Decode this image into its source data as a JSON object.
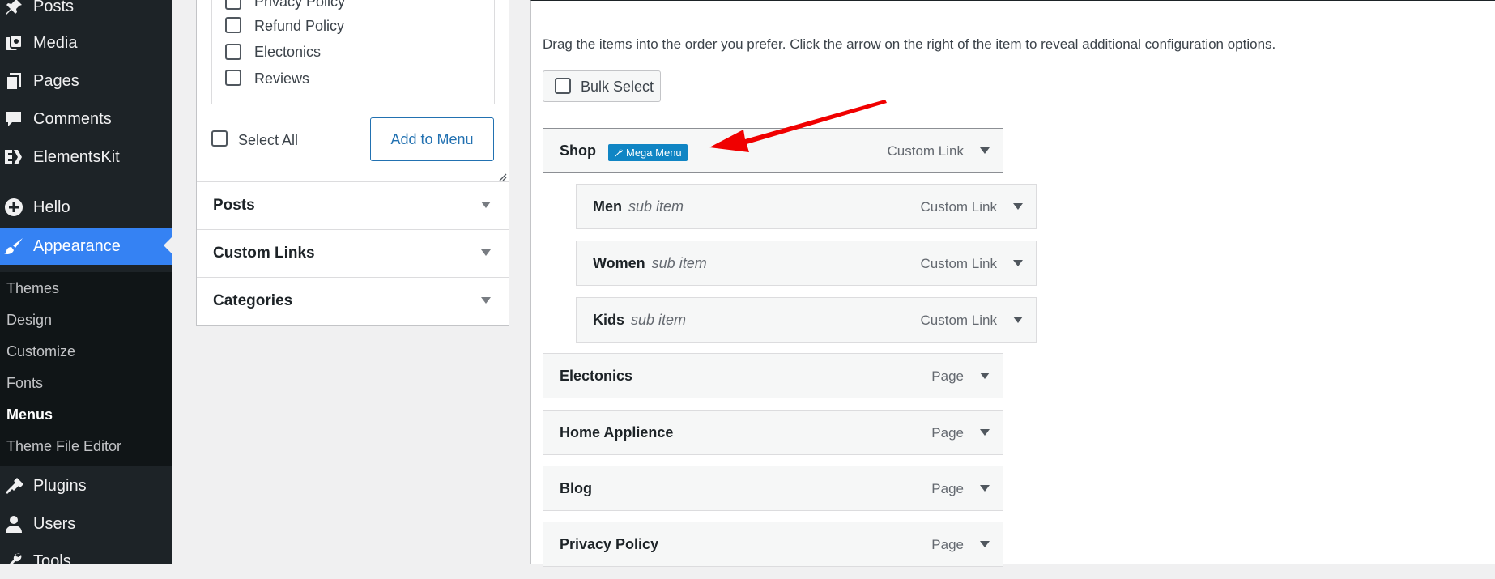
{
  "sidebar": {
    "items": [
      {
        "label": "Posts",
        "icon": "pin-icon"
      },
      {
        "label": "Media",
        "icon": "media-icon"
      },
      {
        "label": "Pages",
        "icon": "pages-icon"
      },
      {
        "label": "Comments",
        "icon": "comment-icon"
      },
      {
        "label": "ElementsKit",
        "icon": "elementskit-icon"
      },
      {
        "label": "Hello",
        "icon": "plus-circle-icon"
      },
      {
        "label": "Appearance",
        "icon": "brush-icon"
      },
      {
        "label": "Plugins",
        "icon": "plugin-icon"
      },
      {
        "label": "Users",
        "icon": "user-icon"
      },
      {
        "label": "Tools",
        "icon": "wrench-icon"
      }
    ],
    "appearance_submenu": [
      "Themes",
      "Design",
      "Customize",
      "Fonts",
      "Menus",
      "Theme File Editor"
    ]
  },
  "left_panel": {
    "pages": [
      "Privacy Policy",
      "Refund Policy",
      "Electonics",
      "Reviews"
    ],
    "select_all": "Select All",
    "add_button": "Add to Menu",
    "accordions": [
      "Posts",
      "Custom Links",
      "Categories"
    ]
  },
  "right_panel": {
    "instructions": "Drag the items into the order you prefer. Click the arrow on the right of the item to reveal additional configuration options.",
    "bulk_select": "Bulk Select",
    "menu_items": [
      {
        "title": "Shop",
        "badge": "Mega Menu",
        "type": "Custom Link"
      },
      {
        "title": "Men",
        "subtitle": "sub item",
        "type": "Custom Link"
      },
      {
        "title": "Women",
        "subtitle": "sub item",
        "type": "Custom Link"
      },
      {
        "title": "Kids",
        "subtitle": "sub item",
        "type": "Custom Link"
      },
      {
        "title": "Electonics",
        "type": "Page"
      },
      {
        "title": "Home Applience",
        "type": "Page"
      },
      {
        "title": "Blog",
        "type": "Page"
      },
      {
        "title": "Privacy Policy",
        "type": "Page"
      }
    ]
  },
  "colors": {
    "sidebar_bg": "#1d2327",
    "active": "#3582f3",
    "mega_badge": "#1085c4",
    "annotation_arrow": "#f00000"
  }
}
